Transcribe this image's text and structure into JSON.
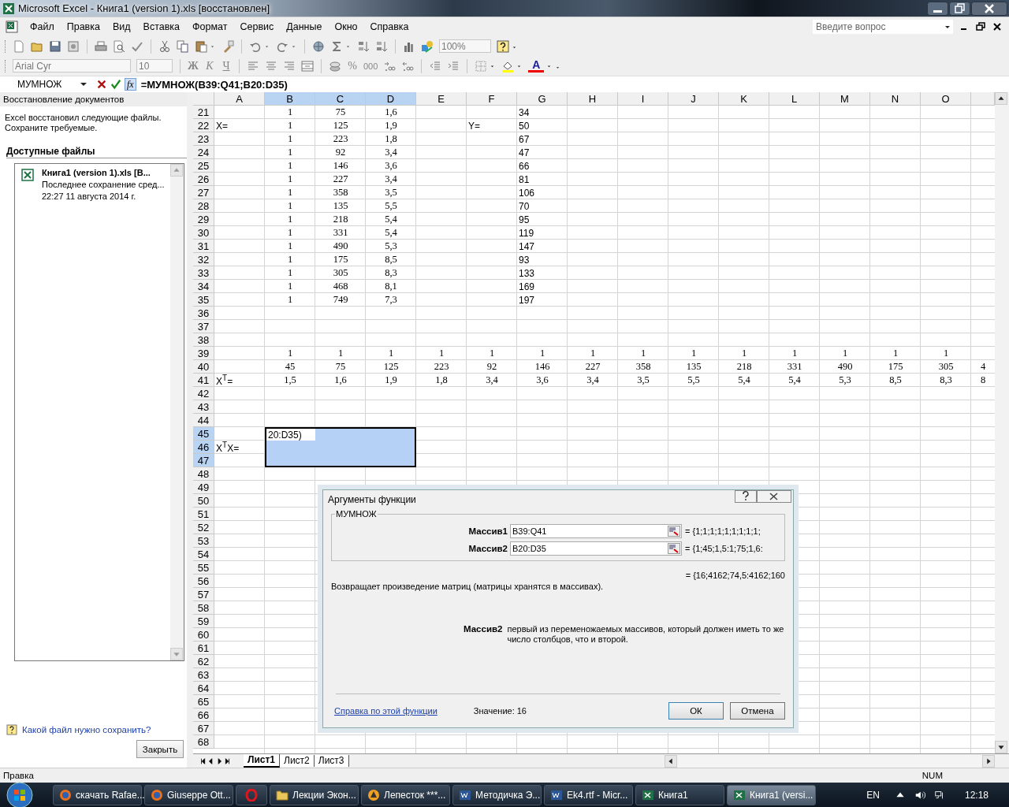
{
  "window": {
    "title": "Microsoft Excel - Книга1 (version 1).xls  [восстановлен]"
  },
  "menu": [
    "Файл",
    "Правка",
    "Вид",
    "Вставка",
    "Формат",
    "Сервис",
    "Данные",
    "Окно",
    "Справка"
  ],
  "question_field": {
    "placeholder": "Введите вопрос"
  },
  "standard_toolbar": {
    "zoom": "100%"
  },
  "formatting_toolbar": {
    "font": "Arial Cyr",
    "size": "10",
    "bold": "Ж",
    "italic": "К",
    "underline": "Ч",
    "percent": "%",
    "thousands": "000",
    "font_color": "A"
  },
  "formula_bar": {
    "name_box": "МУМНОЖ",
    "function_button": "fx",
    "formula": "=МУМНОЖ(B39:Q41;B20:D35)"
  },
  "task_pane": {
    "title": "Восстановление документов",
    "message": "Excel восстановил следующие файлы. Сохраните требуемые.",
    "section": "Доступные файлы",
    "files": [
      {
        "name": "Книга1 (version 1).xls  [В...",
        "detail": "Последнее сохранение сред...",
        "time": "22:27 11 августа 2014 г."
      }
    ],
    "help_link": "Какой файл нужно сохранить?",
    "close_button": "Закрыть"
  },
  "sheet": {
    "columns": [
      {
        "label": "A",
        "selected": false
      },
      {
        "label": "B",
        "selected": true
      },
      {
        "label": "C",
        "selected": true
      },
      {
        "label": "D",
        "selected": true
      },
      {
        "label": "E",
        "selected": false
      },
      {
        "label": "F",
        "selected": false
      },
      {
        "label": "G",
        "selected": false
      },
      {
        "label": "H",
        "selected": false
      },
      {
        "label": "I",
        "selected": false
      },
      {
        "label": "J",
        "selected": false
      },
      {
        "label": "K",
        "selected": false
      },
      {
        "label": "L",
        "selected": false
      },
      {
        "label": "M",
        "selected": false
      },
      {
        "label": "N",
        "selected": false
      },
      {
        "label": "O",
        "selected": false
      },
      {
        "selected": false
      }
    ],
    "rows": [
      {
        "label": "21",
        "selected": false,
        "cells": [
          null,
          "1",
          "75",
          "1,6",
          null,
          null,
          {
            "text": "34",
            "kind": "text"
          }
        ]
      },
      {
        "label": "22",
        "selected": false,
        "cells": [
          {
            "text": "X=",
            "kind": "text"
          },
          "1",
          "125",
          "1,9",
          null,
          {
            "text": "Y=",
            "kind": "text"
          },
          {
            "text": "50",
            "kind": "text"
          }
        ]
      },
      {
        "label": "23",
        "selected": false,
        "cells": [
          null,
          "1",
          "223",
          "1,8",
          null,
          null,
          {
            "text": "67",
            "kind": "text"
          }
        ]
      },
      {
        "label": "24",
        "selected": false,
        "cells": [
          null,
          "1",
          "92",
          "3,4",
          null,
          null,
          {
            "text": "47",
            "kind": "text"
          }
        ]
      },
      {
        "label": "25",
        "selected": false,
        "cells": [
          null,
          "1",
          "146",
          "3,6",
          null,
          null,
          {
            "text": "66",
            "kind": "text"
          }
        ]
      },
      {
        "label": "26",
        "selected": false,
        "cells": [
          null,
          "1",
          "227",
          "3,4",
          null,
          null,
          {
            "text": "81",
            "kind": "text"
          }
        ]
      },
      {
        "label": "27",
        "selected": false,
        "cells": [
          null,
          "1",
          "358",
          "3,5",
          null,
          null,
          {
            "text": "106",
            "kind": "text"
          }
        ]
      },
      {
        "label": "28",
        "selected": false,
        "cells": [
          null,
          "1",
          "135",
          "5,5",
          null,
          null,
          {
            "text": "70",
            "kind": "text"
          }
        ]
      },
      {
        "label": "29",
        "selected": false,
        "cells": [
          null,
          "1",
          "218",
          "5,4",
          null,
          null,
          {
            "text": "95",
            "kind": "text"
          }
        ]
      },
      {
        "label": "30",
        "selected": false,
        "cells": [
          null,
          "1",
          "331",
          "5,4",
          null,
          null,
          {
            "text": "119",
            "kind": "text"
          }
        ]
      },
      {
        "label": "31",
        "selected": false,
        "cells": [
          null,
          "1",
          "490",
          "5,3",
          null,
          null,
          {
            "text": "147",
            "kind": "text"
          }
        ]
      },
      {
        "label": "32",
        "selected": false,
        "cells": [
          null,
          "1",
          "175",
          "8,5",
          null,
          null,
          {
            "text": "93",
            "kind": "text"
          }
        ]
      },
      {
        "label": "33",
        "selected": false,
        "cells": [
          null,
          "1",
          "305",
          "8,3",
          null,
          null,
          {
            "text": "133",
            "kind": "text"
          }
        ]
      },
      {
        "label": "34",
        "selected": false,
        "cells": [
          null,
          "1",
          "468",
          "8,1",
          null,
          null,
          {
            "text": "169",
            "kind": "text"
          }
        ]
      },
      {
        "label": "35",
        "selected": false,
        "cells": [
          null,
          "1",
          "749",
          "7,3",
          null,
          null,
          {
            "text": "197",
            "kind": "text"
          }
        ]
      },
      {
        "label": "36",
        "selected": false,
        "cells": []
      },
      {
        "label": "37",
        "selected": false,
        "cells": []
      },
      {
        "label": "38",
        "selected": false,
        "cells": []
      },
      {
        "label": "39",
        "selected": false,
        "cells": [
          null,
          "1",
          "1",
          "1",
          "1",
          "1",
          "1",
          "1",
          "1",
          "1",
          "1",
          "1",
          "1",
          "1",
          "1"
        ]
      },
      {
        "label": "40",
        "selected": false,
        "cells": [
          null,
          "45",
          "75",
          "125",
          "223",
          "92",
          "146",
          "227",
          "358",
          "135",
          "218",
          "331",
          "490",
          "175",
          "305",
          "4"
        ]
      },
      {
        "label": "41",
        "selected": false,
        "cells": [
          {
            "text": "X$^{T}$=",
            "kind": "text"
          },
          "1,5",
          "1,6",
          "1,9",
          "1,8",
          "3,4",
          "3,6",
          "3,4",
          "3,5",
          "5,5",
          "5,4",
          "5,4",
          "5,3",
          "8,5",
          "8,3",
          "8"
        ]
      },
      {
        "label": "42",
        "selected": false,
        "cells": []
      },
      {
        "label": "43",
        "selected": false,
        "cells": []
      },
      {
        "label": "44",
        "selected": false,
        "cells": []
      },
      {
        "label": "45",
        "selected": true,
        "cells": [
          null,
          {
            "text": "20:D35)",
            "kind": "text",
            "editing": true
          }
        ]
      },
      {
        "label": "46",
        "selected": true,
        "cells": [
          {
            "text": "X$^{T}$X=",
            "kind": "text"
          }
        ]
      },
      {
        "label": "47",
        "selected": true,
        "cells": []
      },
      {
        "label": "48",
        "selected": false,
        "cells": []
      },
      {
        "label": "49",
        "selected": false,
        "cells": []
      },
      {
        "label": "50",
        "selected": false,
        "cells": []
      },
      {
        "label": "51",
        "selected": false,
        "cells": []
      },
      {
        "label": "52",
        "selected": false,
        "cells": []
      },
      {
        "label": "53",
        "selected": false,
        "cells": []
      },
      {
        "label": "54",
        "selected": false,
        "cells": []
      },
      {
        "label": "55",
        "selected": false,
        "cells": []
      },
      {
        "label": "56",
        "selected": false,
        "cells": []
      },
      {
        "label": "57",
        "selected": false,
        "cells": []
      },
      {
        "label": "58",
        "selected": false,
        "cells": []
      },
      {
        "label": "59",
        "selected": false,
        "cells": []
      },
      {
        "label": "60",
        "selected": false,
        "cells": []
      },
      {
        "label": "61",
        "selected": false,
        "cells": []
      },
      {
        "label": "62",
        "selected": false,
        "cells": []
      },
      {
        "label": "63",
        "selected": false,
        "cells": []
      },
      {
        "label": "64",
        "selected": false,
        "cells": []
      },
      {
        "label": "65",
        "selected": false,
        "cells": []
      },
      {
        "label": "66",
        "selected": false,
        "cells": []
      },
      {
        "label": "67",
        "selected": false,
        "cells": []
      },
      {
        "label": "68",
        "selected": false,
        "cells": []
      }
    ]
  },
  "dialog": {
    "title": "Аргументы функции",
    "function": "МУМНОЖ",
    "arguments": [
      {
        "label": "Массив1",
        "value": "B39:Q41",
        "result": "= {1;1;1;1;1;1;1;1;1;"
      },
      {
        "label": "Массив2",
        "value": "B20:D35",
        "result": "= {1;45;1,5:1;75;1,6:"
      }
    ],
    "result": "= {16;4162;74,5:4162;160",
    "description": "Возвращает произведение матриц (матрицы хранятся в массивах).",
    "argument_help": {
      "label": "Массив2",
      "text": "первый из переменожаемых массивов, который должен иметь то же число столбцов, что и второй."
    },
    "help_link": "Справка по этой функции",
    "value": "Значение: 16",
    "buttons": [
      "ОК",
      "Отмена"
    ]
  },
  "sheet_tabs": [
    {
      "label": "Лист1",
      "selected": true
    },
    {
      "label": "Лист2",
      "selected": false
    },
    {
      "label": "Лист3",
      "selected": false
    }
  ],
  "status_bar": {
    "mode": "Правка",
    "indicator": "NUM"
  },
  "taskbar": {
    "items": [
      {
        "label": "скачать Rafae...",
        "kind": "browser",
        "selected": false
      },
      {
        "label": "Giuseppe Ott...",
        "kind": "browser",
        "selected": false
      },
      {
        "kind": "opera",
        "selected": false
      },
      {
        "label": "Лекции Экон...",
        "kind": "folder",
        "selected": false
      },
      {
        "label": "Лепесток ***...",
        "kind": "warning",
        "selected": false
      },
      {
        "label": "Методичка Э...",
        "kind": "word",
        "selected": false
      },
      {
        "label": "Ek4.rtf - Micr...",
        "kind": "word",
        "selected": false
      },
      {
        "label": "Книга1",
        "kind": "excel",
        "selected": false
      },
      {
        "label": "Книга1 (versi...",
        "kind": "excel",
        "selected": true
      }
    ],
    "language": "EN",
    "time": "12:18"
  }
}
